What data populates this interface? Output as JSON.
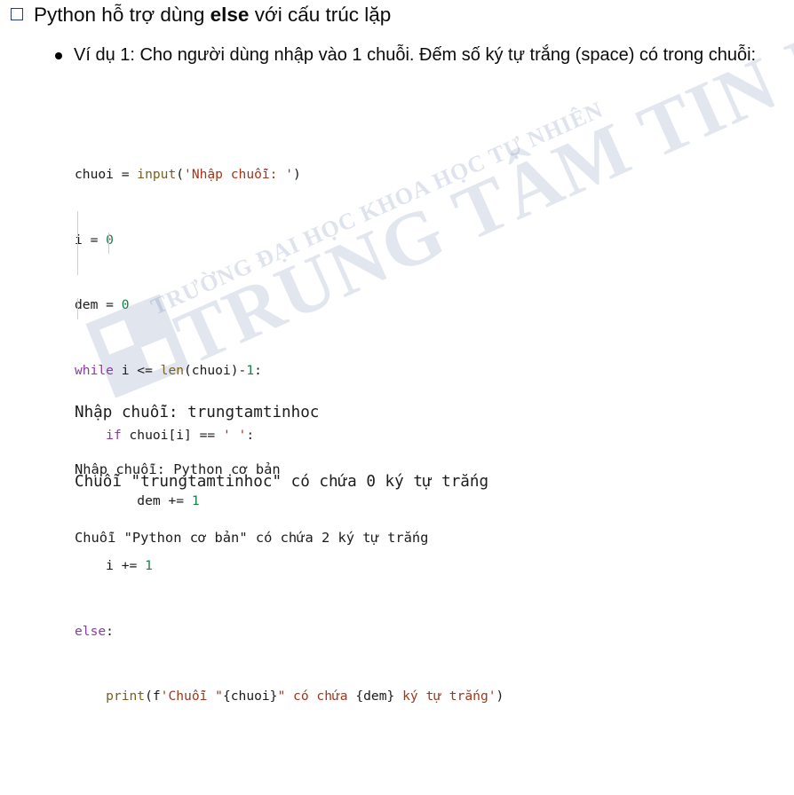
{
  "heading": {
    "text_pre": "Python hỗ trợ dùng ",
    "text_bold": "else",
    "text_post": " với cấu trúc lặp"
  },
  "bullet": {
    "text": "Ví dụ 1: Cho người dùng nhập vào 1 chuỗi. Đếm số ký tự trắng (space) có trong chuỗi:"
  },
  "code": {
    "l1_a": "chuoi = ",
    "l1_fn": "input",
    "l1_b": "(",
    "l1_str": "'Nhập chuỗi: '",
    "l1_c": ")",
    "l2_a": "i = ",
    "l2_num": "0",
    "l3_a": "dem = ",
    "l3_num": "0",
    "l4_kw": "while",
    "l4_a": " i <= ",
    "l4_fn": "len",
    "l4_b": "(chuoi)-",
    "l4_num": "1",
    "l4_c": ":",
    "l5_kw": "if",
    "l5_a": " chuoi[i] == ",
    "l5_str": "' '",
    "l5_b": ":",
    "l6_a": "dem += ",
    "l6_num": "1",
    "l7_a": "i += ",
    "l7_num": "1",
    "l8_kw": "else",
    "l8_a": ":",
    "l9_fn": "print",
    "l9_a": "(f",
    "l9_s1": "'Chuỗi \"",
    "l9_v1": "{chuoi}",
    "l9_s2": "\" có chứa ",
    "l9_v2": "{dem}",
    "l9_s3": " ký tự trắng'",
    "l9_b": ")"
  },
  "output1": {
    "line1": "Nhập chuỗi: trungtamtinhoc",
    "line2": "Chuỗi \"trungtamtinhoc\" có chứa 0 ký tự trắng"
  },
  "output2": {
    "line1": "Nhập chuỗi: Python cơ bản",
    "line2": "Chuỗi \"Python cơ bản\" có chứa 2 ký tự trắng"
  },
  "watermark": {
    "school": "TRƯỜNG ĐẠI HỌC KHOA HỌC TỰ NHIÊN",
    "center": "TRUNG TÂM TIN HỌC",
    "logo_text": "TT"
  },
  "colors": {
    "keyword": "#8b3aa8",
    "function": "#7b5f1e",
    "string": "#a1361a",
    "number": "#1a7d45",
    "checkbox": "#1f3f8a"
  }
}
